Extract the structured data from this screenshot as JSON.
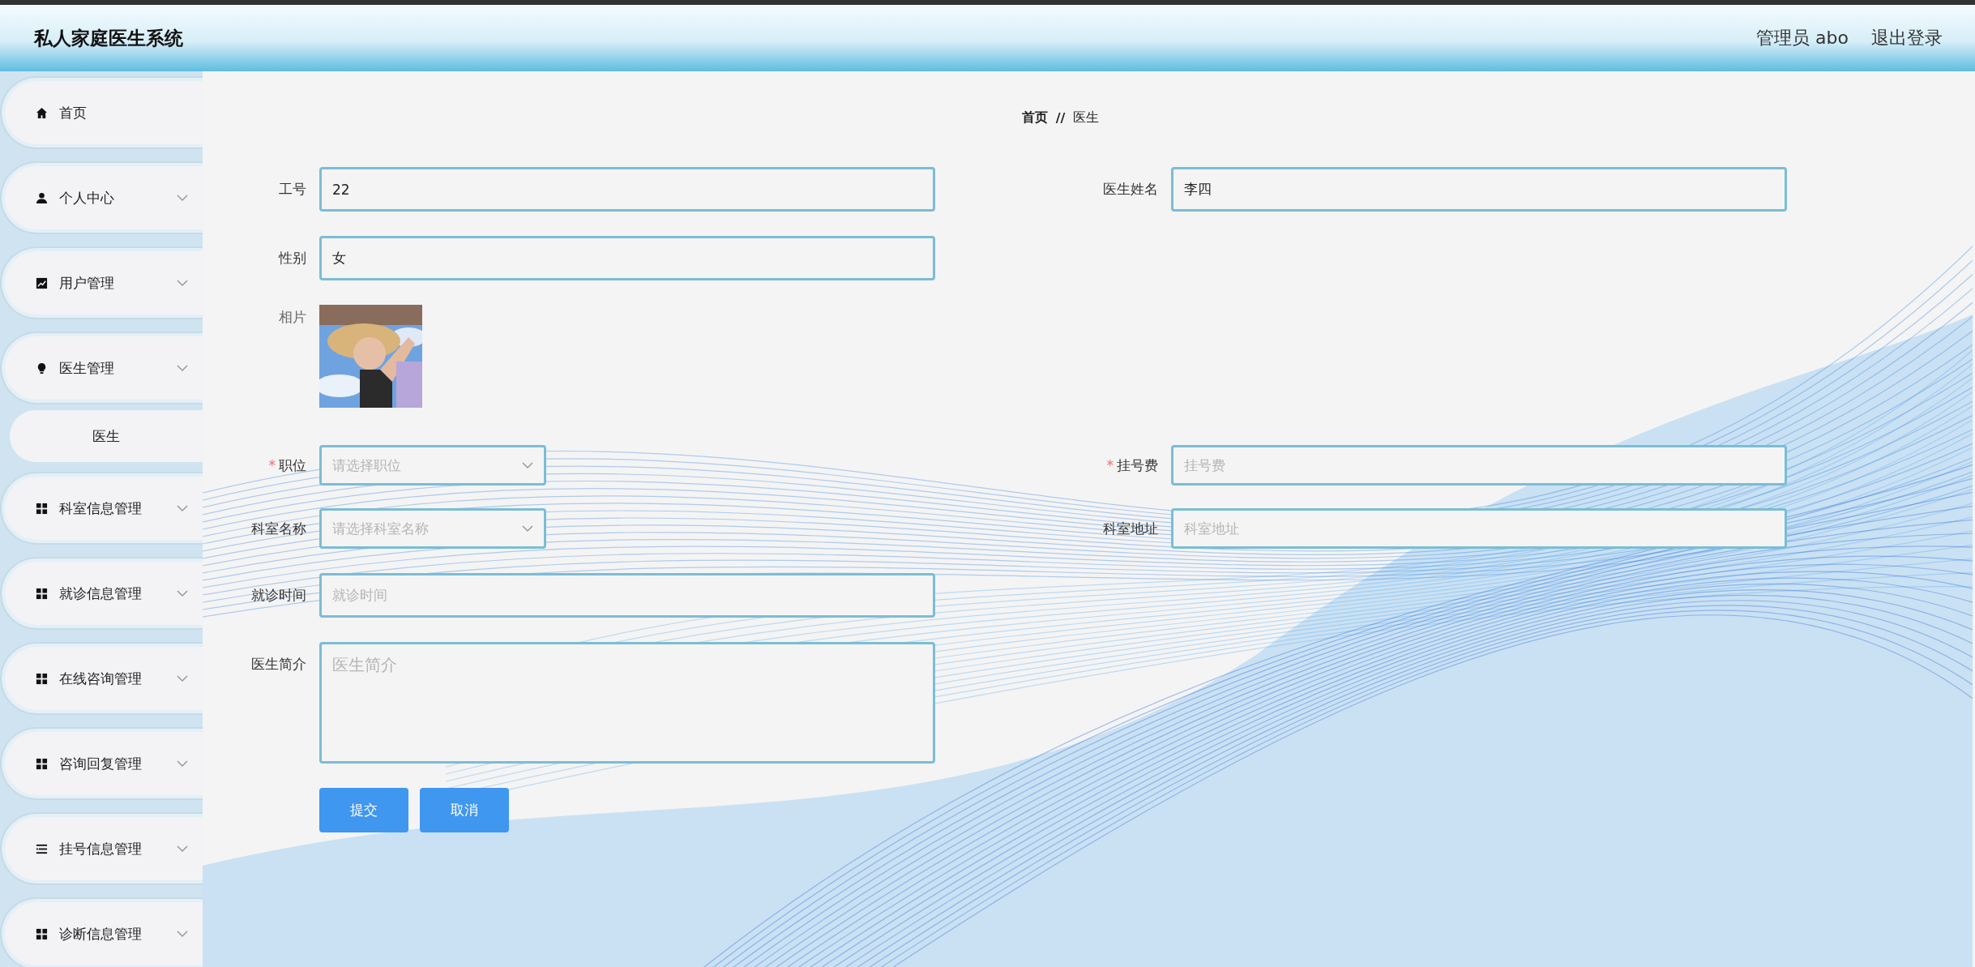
{
  "header": {
    "title": "私人家庭医生系统",
    "user": "管理员 abo",
    "logout": "退出登录"
  },
  "sidebar": {
    "items": [
      {
        "label": "首页",
        "expandable": false
      },
      {
        "label": "个人中心",
        "expandable": true
      },
      {
        "label": "用户管理",
        "expandable": true
      },
      {
        "label": "医生管理",
        "expandable": true,
        "children": [
          {
            "label": "医生"
          }
        ]
      },
      {
        "label": "科室信息管理",
        "expandable": true
      },
      {
        "label": "就诊信息管理",
        "expandable": true
      },
      {
        "label": "在线咨询管理",
        "expandable": true
      },
      {
        "label": "咨询回复管理",
        "expandable": true
      },
      {
        "label": "挂号信息管理",
        "expandable": true
      },
      {
        "label": "诊断信息管理",
        "expandable": true
      }
    ]
  },
  "breadcrumb": {
    "home": "首页",
    "separator": "//",
    "current": "医生"
  },
  "form": {
    "rows": [
      [
        {
          "kind": "input",
          "label": "工号",
          "value": "22"
        },
        {
          "kind": "input",
          "label": "医生姓名",
          "value": "李四"
        }
      ],
      [
        {
          "kind": "input",
          "label": "性别",
          "value": "女"
        }
      ],
      [
        {
          "label": "相片"
        }
      ],
      [
        {
          "kind": "select",
          "required_mark": "*",
          "label": "职位",
          "placeholder": "请选择职位"
        },
        {
          "kind": "input",
          "required_mark": "*",
          "label": "挂号费",
          "placeholder": "挂号费"
        }
      ],
      [
        {
          "kind": "select",
          "label": "科室名称",
          "placeholder": "请选择科室名称"
        },
        {
          "kind": "input",
          "label": "科室地址",
          "placeholder": "科室地址"
        }
      ],
      [
        {
          "kind": "input",
          "label": "就诊时间",
          "placeholder": "就诊时间"
        }
      ],
      [
        {
          "kind": "textarea",
          "label": "医生简介",
          "placeholder": "医生简介"
        }
      ]
    ],
    "buttons": [
      "提交",
      "取消"
    ]
  }
}
